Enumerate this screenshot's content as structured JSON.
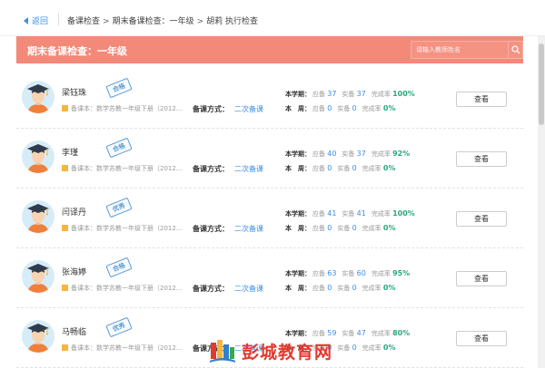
{
  "nav": {
    "back_label": "返回",
    "breadcrumb": [
      "备课检查",
      "期末备课检查：一年级",
      "胡莉 执行检查"
    ]
  },
  "header": {
    "title": "期末备课检查：一年级",
    "search_placeholder": "请输入教师姓名"
  },
  "labels": {
    "book_prefix": "备课本：",
    "method_label": "备课方式：",
    "semester_label": "本学期：",
    "week_label": "本　周：",
    "due_label": "应备",
    "done_label": "实备",
    "rate_label": "完成率",
    "view_button": "查看"
  },
  "teachers": [
    {
      "name": "梁钰珠",
      "stamp": "合格",
      "book": "数学苏教一年级下册（2012...",
      "method": "二次备课",
      "semester": {
        "due": "37",
        "done": "37",
        "rate": "100%"
      },
      "week": {
        "due": "0",
        "done": "0",
        "rate": "0%"
      }
    },
    {
      "name": "李瑾",
      "stamp": "合格",
      "book": "数学苏教一年级下册（2012...",
      "method": "二次备课",
      "semester": {
        "due": "40",
        "done": "37",
        "rate": "92%"
      },
      "week": {
        "due": "0",
        "done": "0",
        "rate": "0%"
      }
    },
    {
      "name": "闫译丹",
      "stamp": "优秀",
      "book": "数学苏教一年级下册（2012...",
      "method": "二次备课",
      "semester": {
        "due": "41",
        "done": "41",
        "rate": "100%"
      },
      "week": {
        "due": "0",
        "done": "0",
        "rate": "0%"
      }
    },
    {
      "name": "张海婷",
      "stamp": "合格",
      "book": "数学苏教一年级下册（2012...",
      "method": "二次备课",
      "semester": {
        "due": "63",
        "done": "60",
        "rate": "95%"
      },
      "week": {
        "due": "0",
        "done": "0",
        "rate": "0%"
      }
    },
    {
      "name": "马畅临",
      "stamp": "优秀",
      "book": "数学苏教一年级下册（2012...",
      "method": "二次备课",
      "semester": {
        "due": "59",
        "done": "47",
        "rate": "80%"
      },
      "week": {
        "due": "0",
        "done": "0",
        "rate": "0%"
      }
    }
  ],
  "watermark": {
    "text": "彭城教育网"
  },
  "icons": {
    "back": "arrow-left-icon",
    "search": "search-icon",
    "avatar": "graduate-avatar-icon",
    "book": "book-icon",
    "logo": "site-logo-icon"
  },
  "colors": {
    "header_bg": "#f38979",
    "link": "#3a8ee6",
    "success": "#2aa87d",
    "stamp": "#5b9bd5",
    "watermark": "#e23a2f"
  }
}
